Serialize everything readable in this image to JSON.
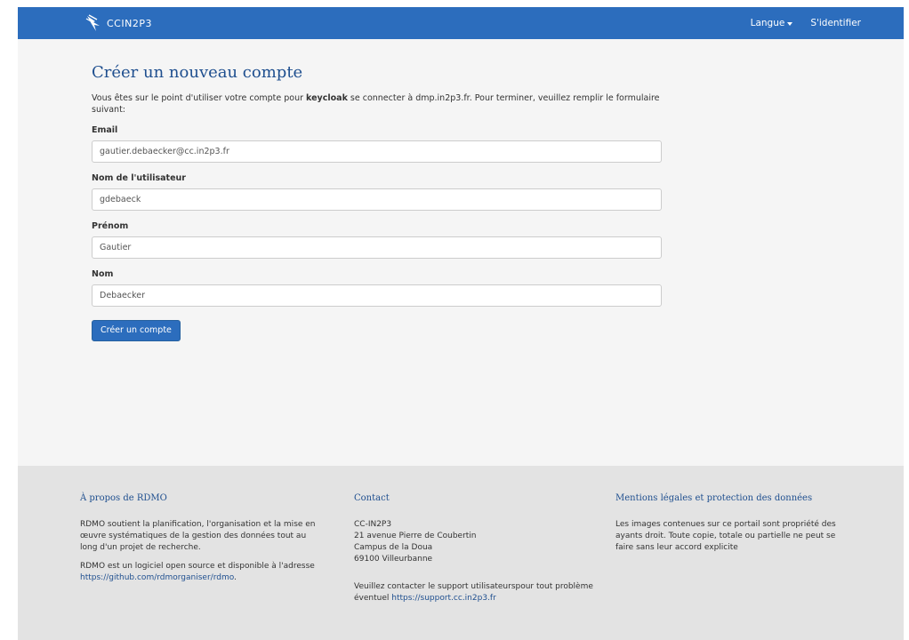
{
  "navbar": {
    "brand_text": "CCIN2P3",
    "language_label": "Langue",
    "login_label": "S'identifier"
  },
  "main": {
    "title": "Créer un nouveau compte",
    "intro_before": "Vous êtes sur le point d'utiliser votre compte pour ",
    "intro_bold": "keycloak",
    "intro_after": " se connecter à dmp.in2p3.fr. Pour terminer, veuillez remplir le formulaire suivant:",
    "fields": [
      {
        "label": "Email",
        "value": "gautier.debaecker@cc.in2p3.fr"
      },
      {
        "label": "Nom de l'utilisateur",
        "value": "gdebaeck"
      },
      {
        "label": "Prénom",
        "value": "Gautier"
      },
      {
        "label": "Nom",
        "value": "Debaecker"
      }
    ],
    "submit_label": "Créer un compte"
  },
  "footer": {
    "about": {
      "title": "À propos de RDMO",
      "p1": "RDMO soutient la planification, l'organisation et la mise en œuvre systématiques de la gestion des données tout au long d'un projet de recherche.",
      "p2_text": "RDMO est un logiciel open source et disponible à l'adresse ",
      "p2_link": "https://github.com/rdmorganiser/rdmo",
      "p2_end": "."
    },
    "contact": {
      "title": "Contact",
      "line1": "CC-IN2P3",
      "line2": "21 avenue Pierre de Coubertin",
      "line3": "Campus de la Doua",
      "line4": "69100 Villeurbanne",
      "support_text": "Veuillez contacter le support utilisateurspour tout problème éventuel ",
      "support_link": "https://support.cc.in2p3.fr"
    },
    "legal": {
      "title": "Mentions légales et protection des données",
      "text": "Les images contenues sur ce portail sont propriété des ayants droit. Toute copie, totale ou partielle ne peut se faire sans leur accord explicite"
    }
  },
  "colors": {
    "navbar": "#2c6dbd",
    "heading": "#1f4f8f",
    "background": "#f5f5f5",
    "footer": "#e3e3e3"
  },
  "icons": {
    "brand": "logo-icon",
    "language": "caret-down-icon"
  }
}
